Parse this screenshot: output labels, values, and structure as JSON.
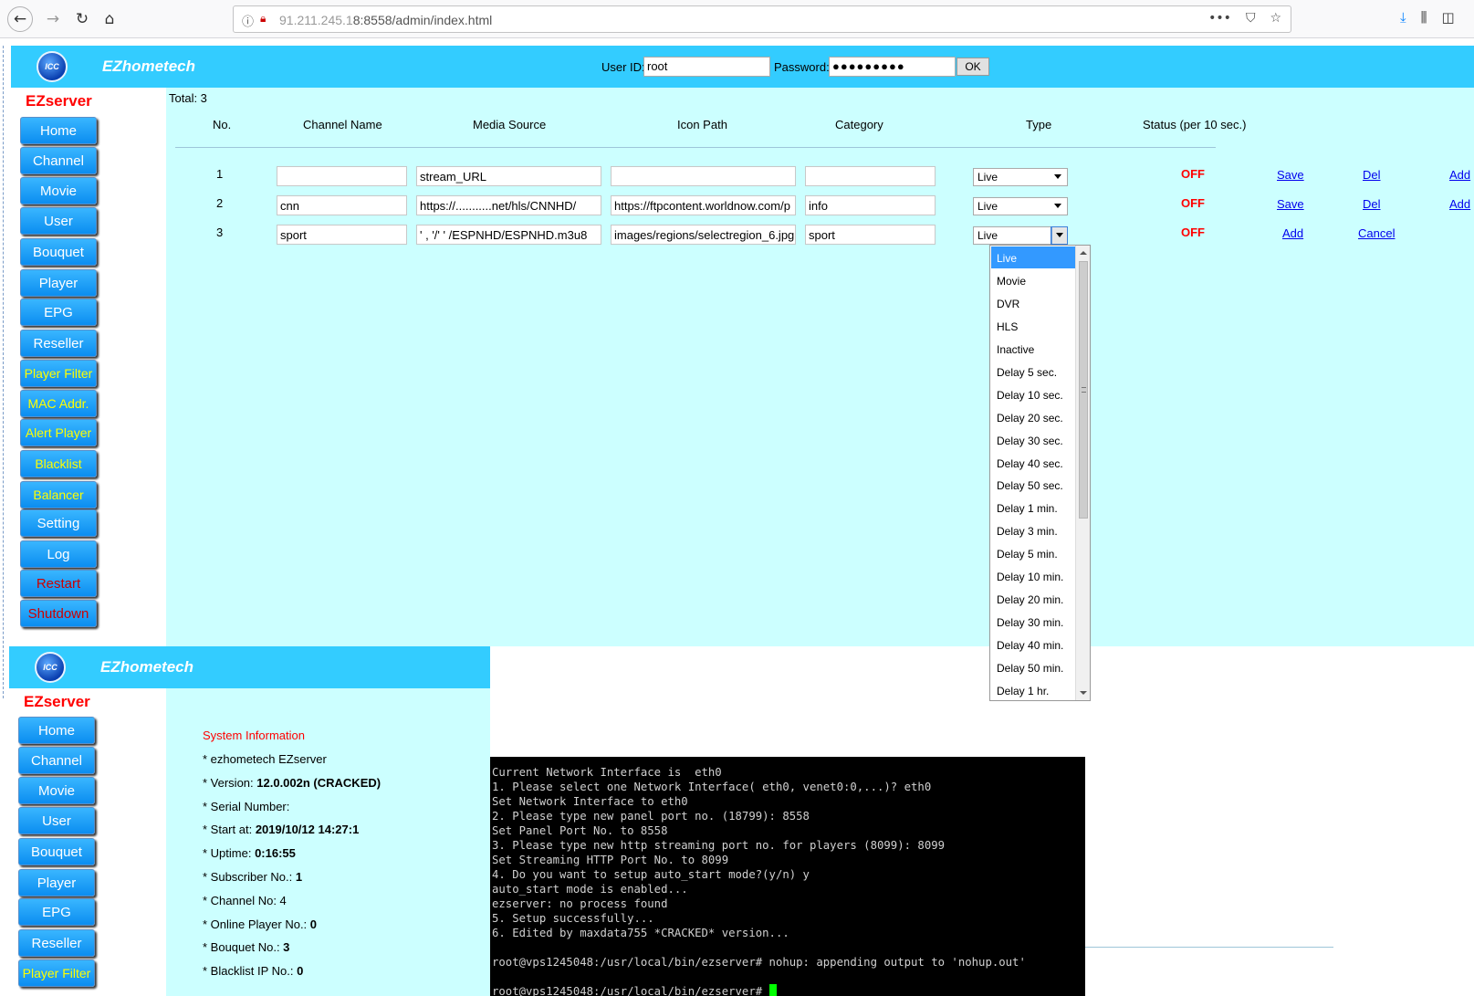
{
  "browser": {
    "url_host": "91.211.245.1",
    "url_path": "8:8558/admin/index.html",
    "menu_dots": "•••"
  },
  "header": {
    "brand": "EZhometech",
    "logo_text": "ICC",
    "user_id_label": "User ID:",
    "user_id_value": "root",
    "password_label": "Password:",
    "password_value": "●●●●●●●●●",
    "ok_label": "OK"
  },
  "sidebar": {
    "title": "EZserver",
    "items": [
      {
        "label": "Home"
      },
      {
        "label": "Channel"
      },
      {
        "label": "Movie"
      },
      {
        "label": "User"
      },
      {
        "label": "Bouquet"
      },
      {
        "label": "Player"
      },
      {
        "label": "EPG"
      },
      {
        "label": "Reseller"
      },
      {
        "label": "Player Filter"
      },
      {
        "label": "MAC Addr."
      },
      {
        "label": "Alert Player"
      },
      {
        "label": "Blacklist"
      },
      {
        "label": "Balancer"
      },
      {
        "label": "Setting"
      },
      {
        "label": "Log"
      },
      {
        "label": "Restart"
      },
      {
        "label": "Shutdown"
      }
    ]
  },
  "channels": {
    "total": "Total: 3",
    "headers": {
      "no": "No.",
      "name": "Channel Name",
      "source": "Media Source",
      "icon": "Icon Path",
      "category": "Category",
      "type": "Type",
      "status": "Status (per 10 sec.)"
    },
    "rows": [
      {
        "no": "1",
        "name": "",
        "source": "stream_URL",
        "icon": "",
        "category": "",
        "type": "Live",
        "status": "OFF",
        "action1": "Save",
        "action2": "Del",
        "action3": "Add"
      },
      {
        "no": "2",
        "name": "cnn",
        "source": "https://...........net/hls/CNNHD/",
        "icon": "https://ftpcontent.worldnow.com/p",
        "category": "info",
        "type": "Live",
        "status": "OFF",
        "action1": "Save",
        "action2": "Del",
        "action3": "Add"
      },
      {
        "no": "3",
        "name": "sport",
        "source": "' ,    '/' ' /ESPNHD/ESPNHD.m3u8",
        "icon": "images/regions/selectregion_6.jpg",
        "category": "sport",
        "type": "Live",
        "status": "OFF",
        "action1": "Add",
        "action2": "Cancel"
      }
    ]
  },
  "type_dropdown": {
    "options": [
      "Live",
      "Movie",
      "DVR",
      "HLS",
      "Inactive",
      "Delay 5 sec.",
      "Delay 10 sec.",
      "Delay 20 sec.",
      "Delay 30 sec.",
      "Delay 40 sec.",
      "Delay 50 sec.",
      "Delay 1 min.",
      "Delay 3 min.",
      "Delay 5 min.",
      "Delay 10 min.",
      "Delay 20 min.",
      "Delay 30 min.",
      "Delay 40 min.",
      "Delay 50 min.",
      "Delay 1 hr."
    ],
    "selected": "Live"
  },
  "window2": {
    "brand": "EZhometech",
    "logo_text": "ICC",
    "title": "EZserver",
    "items": [
      {
        "label": "Home"
      },
      {
        "label": "Channel"
      },
      {
        "label": "Movie"
      },
      {
        "label": "User"
      },
      {
        "label": "Bouquet"
      },
      {
        "label": "Player"
      },
      {
        "label": "EPG"
      },
      {
        "label": "Reseller"
      },
      {
        "label": "Player Filter"
      }
    ],
    "sysinfo": {
      "title": "System Information",
      "lines": [
        {
          "label": "* ezhometech EZserver",
          "value": ""
        },
        {
          "label": "* Version: ",
          "value": "12.0.002n (CRACKED)"
        },
        {
          "label": "* Serial Number:",
          "value": ""
        },
        {
          "label": "* Start at: ",
          "value": "2019/10/12 14:27:1"
        },
        {
          "label": "* Uptime: ",
          "value": "0:16:55"
        },
        {
          "label": "* Subscriber No.: ",
          "value": "1"
        },
        {
          "label": "* Channel No: 4",
          "value": ""
        },
        {
          "label": "* Online Player No.: ",
          "value": "0"
        },
        {
          "label": "* Bouquet No.: ",
          "value": "3"
        },
        {
          "label": "* Blacklist IP No.: ",
          "value": "0"
        }
      ]
    }
  },
  "terminal": {
    "lines": [
      "Current Network Interface is  eth0",
      "1. Please select one Network Interface( eth0, venet0:0,...)? eth0",
      "Set Network Interface to eth0",
      "2. Please type new panel port no. (18799): 8558",
      "Set Panel Port No. to 8558",
      "3. Please type new http streaming port no. for players (8099): 8099",
      "Set Streaming HTTP Port No. to 8099",
      "4. Do you want to setup auto_start mode?(y/n) y",
      "auto_start mode is enabled...",
      "ezserver: no process found",
      "5. Setup successfully...",
      "6. Edited by maxdata755 *CRACKED* version...",
      "",
      "root@vps1245048:/usr/local/bin/ezserver# nohup: appending output to 'nohup.out'",
      ""
    ],
    "prompt": "root@vps1245048:/usr/local/bin/ezserver# "
  }
}
